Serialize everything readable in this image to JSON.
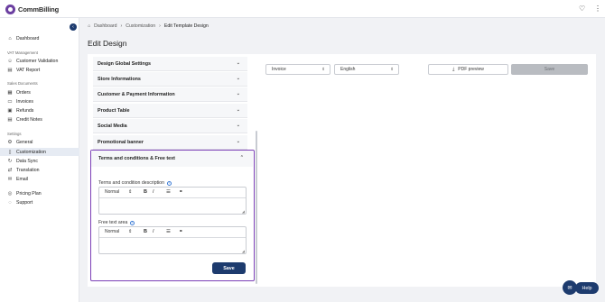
{
  "app": {
    "name": "CommBilling"
  },
  "topbar": {
    "bell_icon": "bell-icon",
    "menu_icon": "kebab-menu-icon"
  },
  "sidebar": {
    "items_top": [
      {
        "label": "Dashboard",
        "icon": "home-icon"
      }
    ],
    "groups": [
      {
        "title": "VAT Management",
        "items": [
          {
            "label": "Customer Validation",
            "icon": "user-check-icon"
          },
          {
            "label": "VAT Report",
            "icon": "report-icon"
          }
        ]
      },
      {
        "title": "Sales Documents",
        "items": [
          {
            "label": "Orders",
            "icon": "orders-icon"
          },
          {
            "label": "Invoices",
            "icon": "invoice-icon"
          },
          {
            "label": "Refunds",
            "icon": "refund-icon"
          },
          {
            "label": "Credit Notes",
            "icon": "credit-note-icon"
          }
        ]
      },
      {
        "title": "Settings",
        "items": [
          {
            "label": "General",
            "icon": "gear-icon"
          },
          {
            "label": "Customization",
            "icon": "document-edit-icon",
            "active": true
          },
          {
            "label": "Data Sync",
            "icon": "sync-icon"
          },
          {
            "label": "Translation",
            "icon": "translate-icon"
          },
          {
            "label": "Email",
            "icon": "mail-icon"
          }
        ]
      }
    ],
    "items_bottom": [
      {
        "label": "Pricing Plan",
        "icon": "pricing-icon"
      },
      {
        "label": "Support",
        "icon": "support-icon"
      }
    ]
  },
  "breadcrumb": {
    "home": "Dashboard",
    "middle": "Customization",
    "current": "Edit Template Design"
  },
  "page": {
    "title": "Edit Design"
  },
  "accordion": [
    "Design Global Settings",
    "Store Informations",
    "Customer & Payment Information",
    "Product Table",
    "Social Media",
    "Promotional banner"
  ],
  "terms": {
    "title": "Terms and conditions & Free text",
    "desc_label": "Terms and condition description",
    "free_label": "Free text area",
    "format_value": "Normal",
    "save_label": "Save"
  },
  "preview": {
    "doc_type": "Invoice",
    "language": "English",
    "pdf_label": "PDF preview",
    "save_label": "Save"
  },
  "help": {
    "label": "Help"
  },
  "colors": {
    "accent": "#1d3b6e",
    "highlight": "#7b3fb6"
  }
}
